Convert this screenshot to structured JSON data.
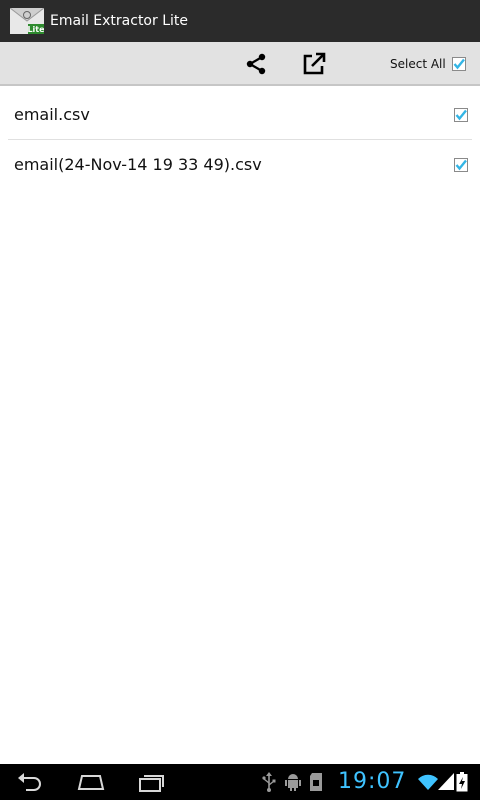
{
  "app": {
    "title": "Email Extractor Lite",
    "icon": "email-app-icon",
    "badge": "Lite"
  },
  "toolbar": {
    "share_icon": "share-icon",
    "open_icon": "open-external-icon",
    "select_all_label": "Select All",
    "select_all_checked": true
  },
  "files": [
    {
      "name": "email.csv",
      "checked": true
    },
    {
      "name": "email(24-Nov-14 19 33 49).csv",
      "checked": true
    }
  ],
  "statusbar": {
    "time": "19:07",
    "icons": [
      "usb-icon",
      "android-debug-icon",
      "sd-card-icon",
      "wifi-icon",
      "signal-icon",
      "battery-icon"
    ]
  },
  "colors": {
    "titlebar": "#2b2b2b",
    "actionbar": "#e2e2e2",
    "accent": "#33b5e5",
    "clock": "#3fc3ff"
  }
}
